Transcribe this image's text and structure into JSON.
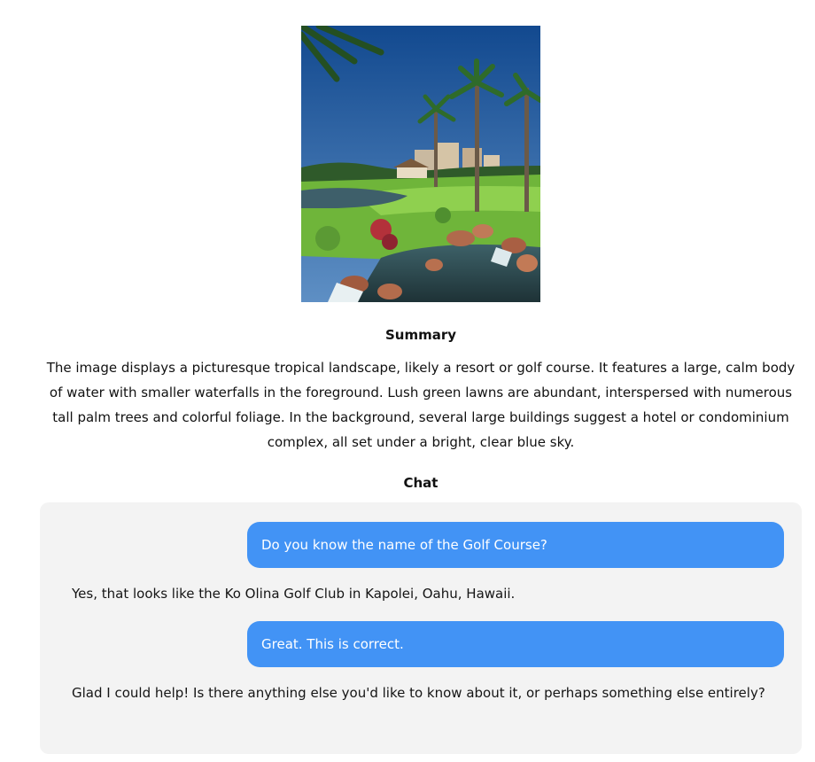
{
  "image": {
    "icon": "landscape-photo",
    "colors": {
      "sky": "#1d5fa8",
      "lawn": "#7cc143",
      "water": "#2b4a55"
    }
  },
  "summary": {
    "heading": "Summary",
    "text": "The image displays a picturesque tropical landscape, likely a resort or golf course. It features a large, calm body of water with smaller waterfalls in the foreground. Lush green lawns are abundant, interspersed with numerous tall palm trees and colorful foliage. In the background, several large buildings suggest a hotel or condominium complex, all set under a bright, clear blue sky."
  },
  "chat": {
    "heading": "Chat",
    "messages": [
      {
        "role": "user",
        "text": "Do you know the name of the Golf Course?"
      },
      {
        "role": "assistant",
        "text": "Yes, that looks like the Ko Olina Golf Club in Kapolei, Oahu, Hawaii."
      },
      {
        "role": "user",
        "text": "Great. This is correct."
      },
      {
        "role": "assistant",
        "text": "Glad I could help! Is there anything else you'd like to know about it, or perhaps something else entirely?"
      }
    ]
  },
  "colors": {
    "user_bubble": "#4293f5",
    "chat_panel": "#f3f3f3",
    "text": "#111111"
  }
}
